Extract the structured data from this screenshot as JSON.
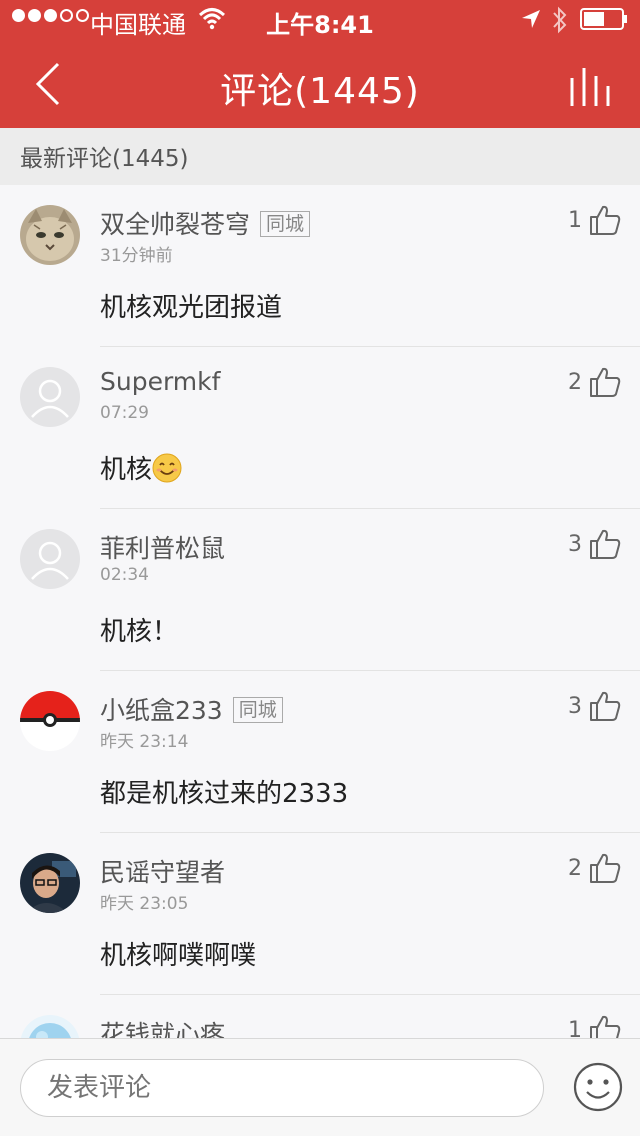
{
  "status_bar": {
    "carrier": "中国联通",
    "time": "上午8:41",
    "signal_dots_filled": 3,
    "signal_dots_total": 5,
    "battery_level": 0.55
  },
  "nav": {
    "title": "评论(1445)",
    "back_icon": "chevron-left-icon",
    "rank_icon": "bars-icon"
  },
  "section": {
    "label": "最新评论(1445)"
  },
  "comments": [
    {
      "name": "双全帅裂苍穹",
      "tag": "同城",
      "time": "31分钟前",
      "text": "机核观光团报道",
      "likes": "1",
      "avatar": "cat-avatar"
    },
    {
      "name": "Supermkf",
      "tag": "",
      "time": "07:29",
      "text": "机核",
      "emoji": "smile-emoji",
      "likes": "2",
      "avatar": "default-avatar"
    },
    {
      "name": "菲利普松鼠",
      "tag": "",
      "time": "02:34",
      "text": "机核！",
      "likes": "3",
      "avatar": "default-avatar"
    },
    {
      "name": "小纸盒233",
      "tag": "同城",
      "time": "昨天 23:14",
      "text": "都是机核过来的2333",
      "likes": "3",
      "avatar": "pokeball-avatar"
    },
    {
      "name": "民谣守望者",
      "tag": "",
      "time": "昨天 23:05",
      "text": "机核啊噗啊噗",
      "likes": "2",
      "avatar": "photo-avatar"
    },
    {
      "name": "花钱就心疼",
      "tag": "",
      "time": "",
      "text": "",
      "likes": "1",
      "avatar": "blue-avatar"
    }
  ],
  "bottom": {
    "input_placeholder": "发表评论",
    "emoji_icon": "smiley-icon"
  },
  "colors": {
    "brand_red": "#d6403a",
    "tag_border": "#aaaaaa"
  }
}
